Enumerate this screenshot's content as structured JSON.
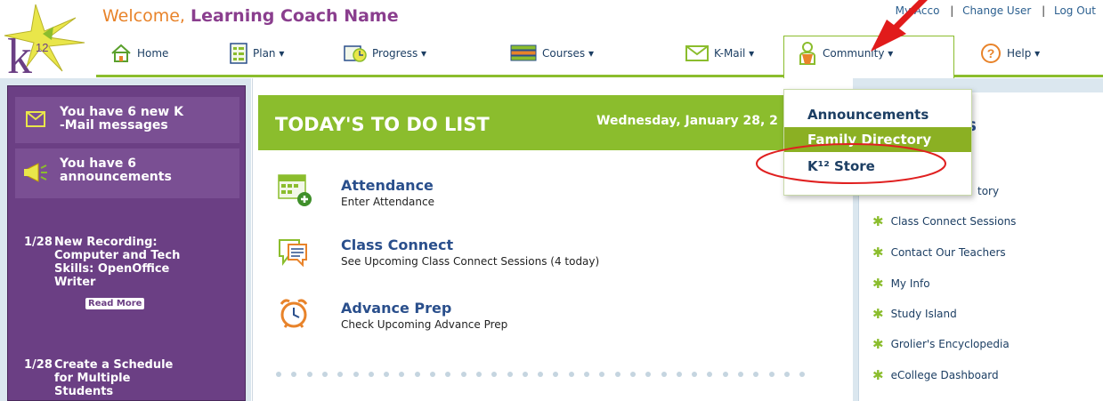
{
  "header": {
    "welcome_prefix": "Welcome,",
    "welcome_name": "Learning Coach Name",
    "top_links": [
      "My Acco",
      "Change User",
      "Log Out"
    ]
  },
  "nav": {
    "items": [
      {
        "label": "Home",
        "icon": "home-icon"
      },
      {
        "label": "Plan ▾",
        "icon": "plan-icon"
      },
      {
        "label": "Progress ▾",
        "icon": "progress-icon"
      },
      {
        "label": "Courses ▾",
        "icon": "courses-icon"
      },
      {
        "label": "K-Mail ▾",
        "icon": "kmail-icon"
      },
      {
        "label": "Community ▾",
        "icon": "community-icon"
      },
      {
        "label": "Help ▾",
        "icon": "help-icon"
      }
    ]
  },
  "dropdown": {
    "items": [
      "Announcements",
      "Family Directory",
      "K¹² Store"
    ],
    "active_index": 1
  },
  "sidebar": {
    "kmail_text": "You have 6 new K-Mail messages",
    "kmail_line1": "You have 6 new K",
    "kmail_line2": "-Mail messages",
    "ann_line1": "You have 6",
    "ann_line2": "announcements",
    "announcements": [
      {
        "date": "1/28",
        "lines": [
          "New Recording:",
          "Computer and Tech",
          "Skills: OpenOffice",
          "Writer"
        ]
      },
      {
        "date": "1/28",
        "lines": [
          "Create a Schedule",
          "for Multiple",
          "Students"
        ]
      }
    ],
    "read_more": "Read More"
  },
  "todo": {
    "title": "TODAY'S TO DO LIST",
    "date": "Wednesday, January 28, 2",
    "tasks": [
      {
        "title": "Attendance",
        "subtitle": "Enter Attendance",
        "icon": "attendance-icon"
      },
      {
        "title": "Class Connect",
        "subtitle": "See Upcoming Class Connect Sessions (4 today)",
        "icon": "class-connect-icon"
      },
      {
        "title": "Advance Prep",
        "subtitle": "Check Upcoming Advance Prep",
        "icon": "alarm-clock-icon"
      }
    ]
  },
  "quick_links": {
    "title": "ks",
    "items": [
      "tory",
      "Class Connect Sessions",
      "Contact Our Teachers",
      "My Info",
      "Study Island",
      "Grolier's Encyclopedia",
      "eCollege Dashboard"
    ]
  },
  "colors": {
    "accent_green": "#8bbd2d",
    "sidebar_purple": "#6b3f84",
    "link_blue": "#2a4f8c",
    "annotation_red": "#e02020"
  }
}
